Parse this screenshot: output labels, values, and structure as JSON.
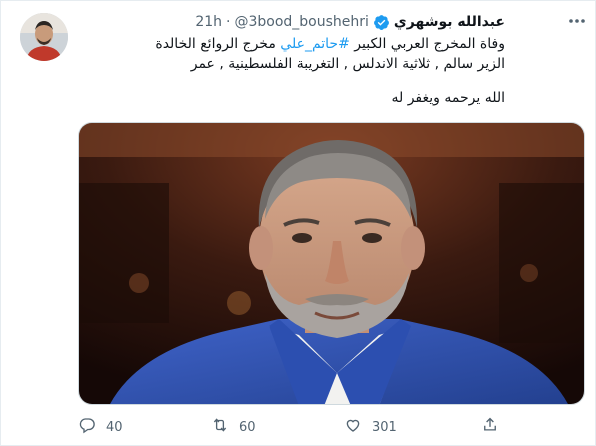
{
  "tweet": {
    "author": {
      "display_name": "عبدالله بوشهري",
      "handle": "@3bood_boushehri",
      "separator": "·",
      "time": "21h",
      "verified": true
    },
    "text": {
      "line1_pre": "وفاة المخرج العربي الكبير ",
      "hashtag": "#حاتم_علي",
      "line1_post": " مخرج الروائع الخالدة",
      "line2": "الزير سالم , ثلاثية الاندلس , التغريبة الفلسطينية , عمر",
      "line3": "الله يرحمه ويغفر له"
    },
    "actions": {
      "replies": "40",
      "retweets": "60",
      "likes": "301"
    }
  },
  "colors": {
    "accent": "#1d9bf0",
    "muted": "#536471",
    "text": "#0f1419"
  }
}
